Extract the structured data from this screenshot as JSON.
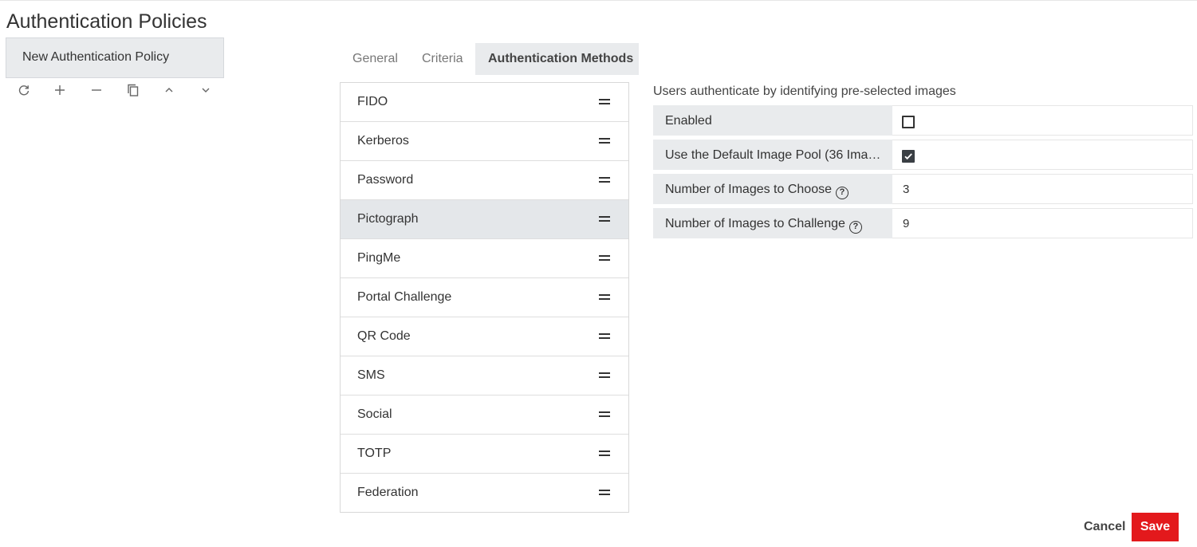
{
  "page": {
    "title": "Authentication Policies"
  },
  "policies": {
    "items": [
      {
        "label": "New Authentication Policy"
      }
    ],
    "toolbar": [
      {
        "name": "refresh-icon"
      },
      {
        "name": "add-icon"
      },
      {
        "name": "remove-icon"
      },
      {
        "name": "copy-icon"
      },
      {
        "name": "chevron-up-icon"
      },
      {
        "name": "chevron-down-icon"
      }
    ]
  },
  "tabs": [
    {
      "label": "General",
      "active": false
    },
    {
      "label": "Criteria",
      "active": false
    },
    {
      "label": "Authentication Methods",
      "active": true
    }
  ],
  "methods": [
    {
      "label": "FIDO"
    },
    {
      "label": "Kerberos"
    },
    {
      "label": "Password"
    },
    {
      "label": "Pictograph",
      "selected": true
    },
    {
      "label": "PingMe"
    },
    {
      "label": "Portal Challenge"
    },
    {
      "label": "QR Code"
    },
    {
      "label": "SMS"
    },
    {
      "label": "Social"
    },
    {
      "label": "TOTP"
    },
    {
      "label": "Federation"
    }
  ],
  "method_detail": {
    "description": "Users authenticate by identifying pre-selected images",
    "settings": [
      {
        "label": "Enabled",
        "type": "checkbox",
        "checked": false
      },
      {
        "label": "Use the Default Image Pool (36 Ima…",
        "type": "checkbox",
        "checked": true
      },
      {
        "label": "Number of Images to Choose",
        "type": "number",
        "value": "3",
        "help": true
      },
      {
        "label": "Number of Images to Challenge",
        "type": "number",
        "value": "9",
        "help": true
      }
    ]
  },
  "actions": {
    "cancel_label": "Cancel",
    "save_label": "Save"
  },
  "colors": {
    "save_bg": "#e3191c",
    "selected_bg": "#e4e7ea",
    "label_bg": "#e9ebed",
    "checkbox_checked": "#3a3f44"
  }
}
